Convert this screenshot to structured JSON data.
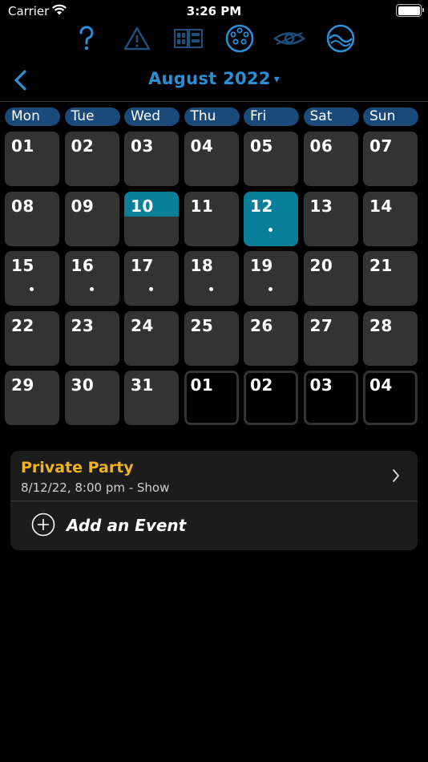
{
  "status_bar": {
    "carrier": "Carrier",
    "time": "3:26 PM"
  },
  "toolbar": {
    "icons": [
      "help-icon",
      "warning-icon",
      "patch-icon",
      "dmx-connector-icon",
      "eye-icon",
      "wave-icon"
    ],
    "accent": "#2a8fd6",
    "muted": "#1e4f7a"
  },
  "header": {
    "title": "August 2022",
    "caret": "▾"
  },
  "weekdays": [
    "Mon",
    "Tue",
    "Wed",
    "Thu",
    "Fri",
    "Sat",
    "Sun"
  ],
  "calendar": {
    "days": [
      {
        "label": "01"
      },
      {
        "label": "02"
      },
      {
        "label": "03"
      },
      {
        "label": "04"
      },
      {
        "label": "05"
      },
      {
        "label": "06"
      },
      {
        "label": "07"
      },
      {
        "label": "08"
      },
      {
        "label": "09"
      },
      {
        "label": "10",
        "today": true
      },
      {
        "label": "11"
      },
      {
        "label": "12",
        "selected": true,
        "event": true
      },
      {
        "label": "13"
      },
      {
        "label": "14"
      },
      {
        "label": "15",
        "event": true
      },
      {
        "label": "16",
        "event": true
      },
      {
        "label": "17",
        "event": true
      },
      {
        "label": "18",
        "event": true
      },
      {
        "label": "19",
        "event": true
      },
      {
        "label": "20"
      },
      {
        "label": "21"
      },
      {
        "label": "22"
      },
      {
        "label": "23"
      },
      {
        "label": "24"
      },
      {
        "label": "25"
      },
      {
        "label": "26"
      },
      {
        "label": "27"
      },
      {
        "label": "28"
      },
      {
        "label": "29"
      },
      {
        "label": "30"
      },
      {
        "label": "31"
      },
      {
        "label": "01",
        "outside": true
      },
      {
        "label": "02",
        "outside": true
      },
      {
        "label": "03",
        "outside": true
      },
      {
        "label": "04",
        "outside": true
      }
    ]
  },
  "event": {
    "title": "Private Party",
    "subtitle": "8/12/22, 8:00 pm - Show"
  },
  "add_event": {
    "label": "Add an Event"
  },
  "colors": {
    "today": "#0a7f99",
    "event_title": "#f0b320",
    "cell": "#333333"
  }
}
